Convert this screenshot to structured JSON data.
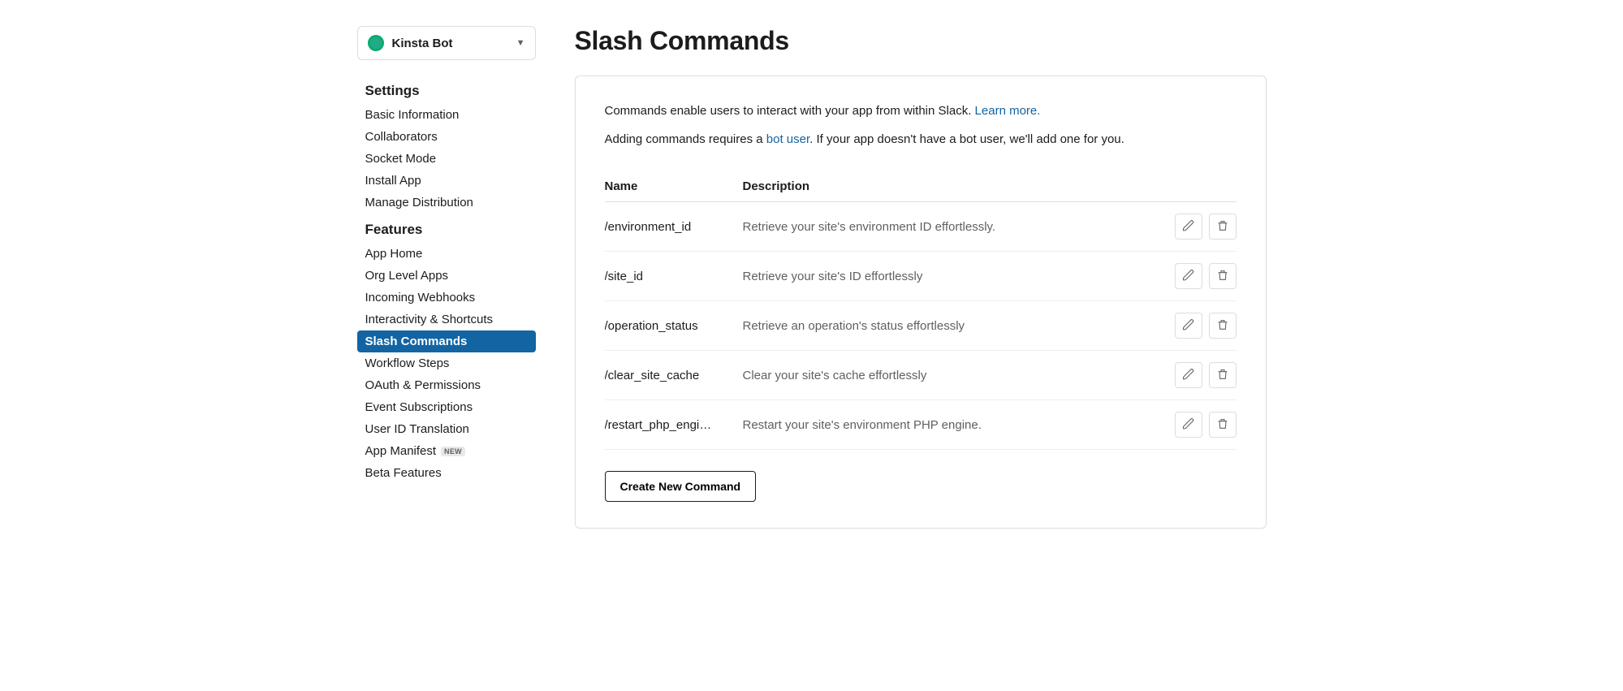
{
  "app_selector": {
    "name": "Kinsta Bot"
  },
  "sidebar": {
    "settings_header": "Settings",
    "settings_items": [
      "Basic Information",
      "Collaborators",
      "Socket Mode",
      "Install App",
      "Manage Distribution"
    ],
    "features_header": "Features",
    "features_items": [
      {
        "label": "App Home",
        "active": false
      },
      {
        "label": "Org Level Apps",
        "active": false
      },
      {
        "label": "Incoming Webhooks",
        "active": false
      },
      {
        "label": "Interactivity & Shortcuts",
        "active": false
      },
      {
        "label": "Slash Commands",
        "active": true
      },
      {
        "label": "Workflow Steps",
        "active": false
      },
      {
        "label": "OAuth & Permissions",
        "active": false
      },
      {
        "label": "Event Subscriptions",
        "active": false
      },
      {
        "label": "User ID Translation",
        "active": false
      },
      {
        "label": "App Manifest",
        "active": false,
        "badge": "NEW"
      },
      {
        "label": "Beta Features",
        "active": false
      }
    ]
  },
  "page": {
    "title": "Slash Commands",
    "intro_text": "Commands enable users to interact with your app from within Slack. ",
    "intro_link": "Learn more.",
    "intro2_pre": "Adding commands requires a ",
    "intro2_link": "bot user",
    "intro2_post": ". If your app doesn't have a bot user, we'll add one for you.",
    "col_name": "Name",
    "col_desc": "Description",
    "create_label": "Create New Command"
  },
  "commands": [
    {
      "name": "/environment_id",
      "desc": "Retrieve your site's environment ID effortlessly."
    },
    {
      "name": "/site_id",
      "desc": "Retrieve your site's ID effortlessly"
    },
    {
      "name": "/operation_status",
      "desc": "Retrieve an operation's status effortlessly"
    },
    {
      "name": "/clear_site_cache",
      "desc": "Clear your site's cache effortlessly"
    },
    {
      "name": "/restart_php_engi…",
      "desc": "Restart your site's environment PHP engine."
    }
  ]
}
